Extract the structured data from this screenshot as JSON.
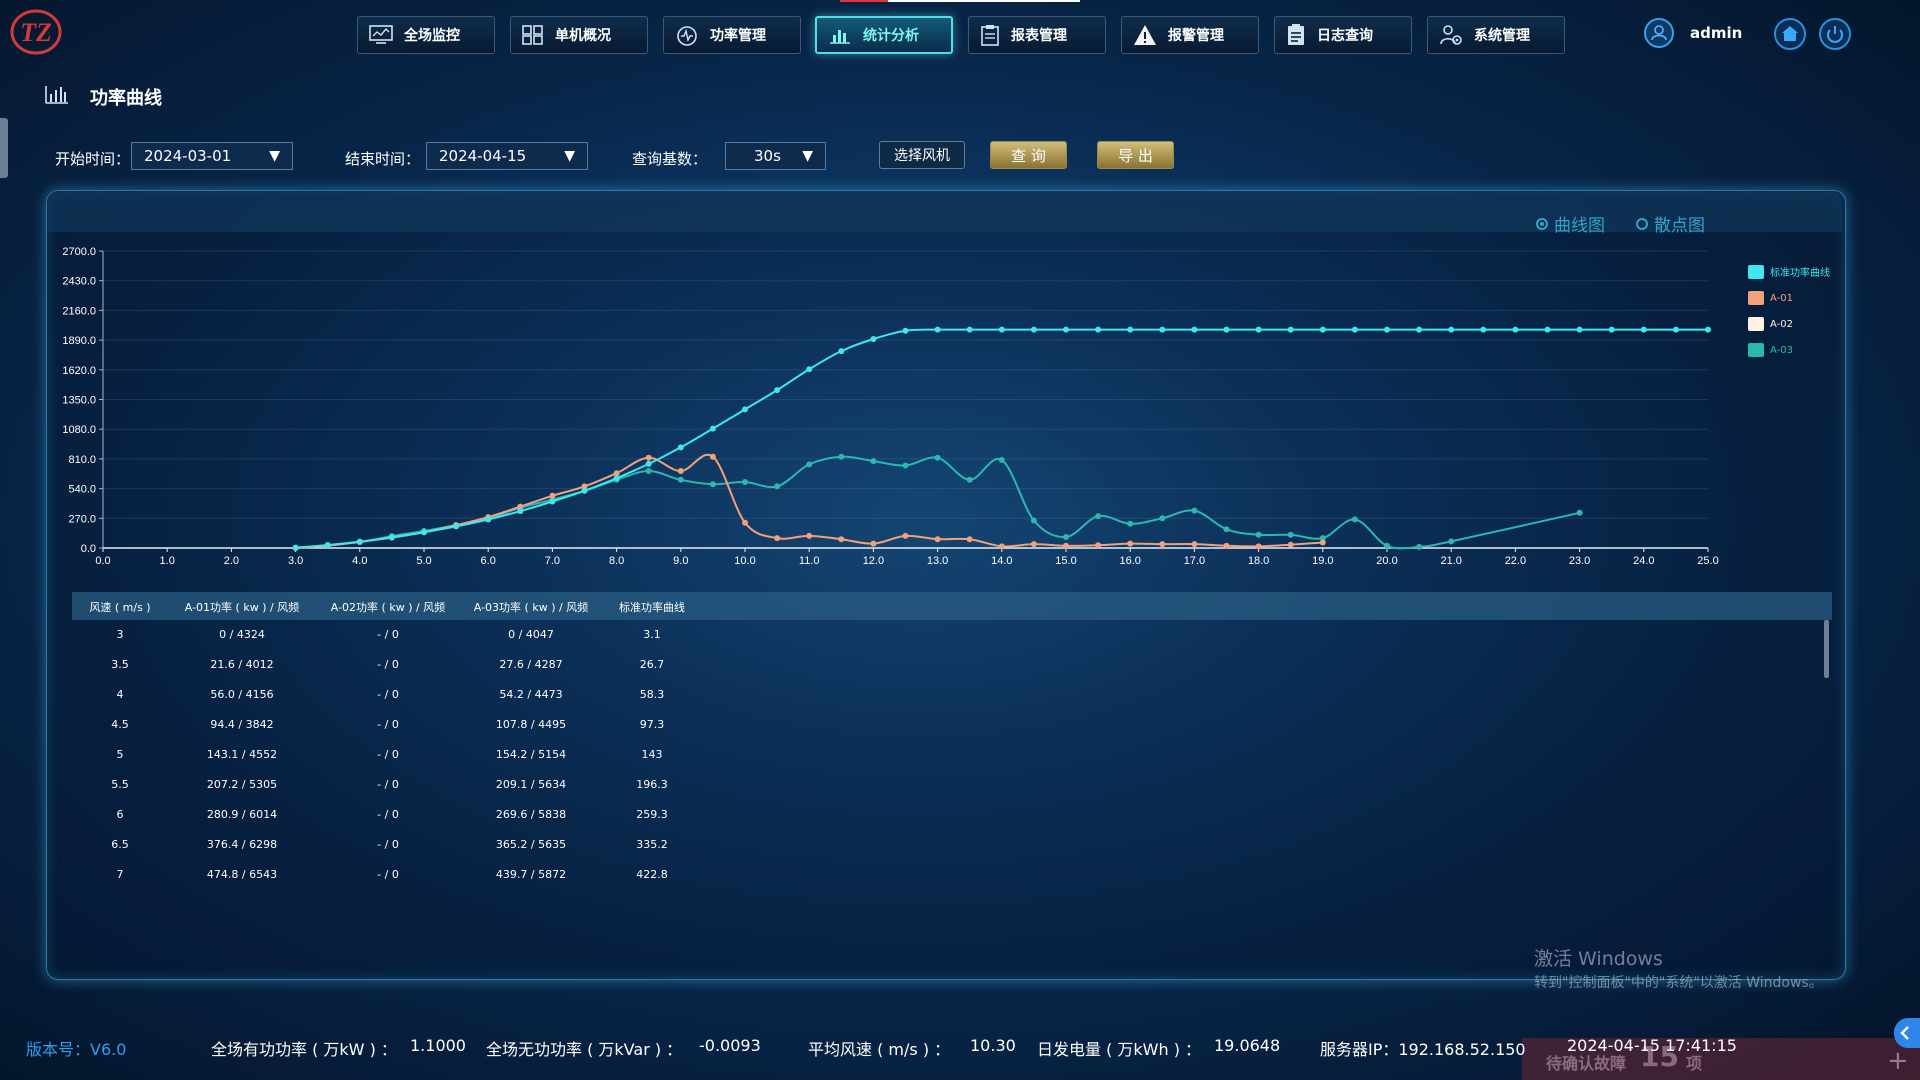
{
  "logo": {
    "text": "TZ"
  },
  "nav": {
    "items": [
      {
        "label": "全场监控",
        "icon": "monitor-icon"
      },
      {
        "label": "单机概况",
        "icon": "grid-icon"
      },
      {
        "label": "功率管理",
        "icon": "power-gauge-icon"
      },
      {
        "label": "统计分析",
        "icon": "bar-chart-icon",
        "active": true
      },
      {
        "label": "报表管理",
        "icon": "clipboard-icon"
      },
      {
        "label": "报警管理",
        "icon": "warning-icon"
      },
      {
        "label": "日志查询",
        "icon": "log-icon"
      },
      {
        "label": "系统管理",
        "icon": "settings-users-icon"
      }
    ],
    "user": "admin"
  },
  "page": {
    "title": "功率曲线"
  },
  "filters": {
    "start_label": "开始时间：",
    "start_value": "2024-03-01",
    "end_label": "结束时间：",
    "end_value": "2024-04-15",
    "base_label": "查询基数：",
    "base_value": "30s",
    "select_turbine": "选择风机",
    "query": "查 询",
    "export": "导 出"
  },
  "view_toggle": {
    "curve": "曲线图",
    "scatter": "散点图",
    "selected": "curve"
  },
  "chart_data": {
    "type": "line",
    "x_ticks": [
      "0.0",
      "1.0",
      "2.0",
      "3.0",
      "4.0",
      "5.0",
      "6.0",
      "7.0",
      "8.0",
      "9.0",
      "10.0",
      "11.0",
      "12.0",
      "13.0",
      "14.0",
      "15.0",
      "16.0",
      "17.0",
      "18.0",
      "19.0",
      "20.0",
      "21.0",
      "22.0",
      "23.0",
      "24.0",
      "25.0"
    ],
    "y_ticks": [
      "0.0",
      "270.0",
      "540.0",
      "810.0",
      "1080.0",
      "1350.0",
      "1620.0",
      "1890.0",
      "2160.0",
      "2430.0",
      "2700.0"
    ],
    "xlim": [
      0,
      25
    ],
    "ylim": [
      0,
      2700
    ],
    "legend_position": "right",
    "series": [
      {
        "name": "标准功率曲线",
        "color": "#3fe6ef",
        "smooth": true,
        "x": [
          3,
          3.5,
          4,
          4.5,
          5,
          5.5,
          6,
          6.5,
          7,
          7.5,
          8,
          8.5,
          9,
          9.5,
          10,
          10.5,
          11,
          11.5,
          12,
          12.5,
          13,
          13.5,
          14,
          14.5,
          15,
          15.5,
          16,
          16.5,
          17,
          17.5,
          18,
          18.5,
          19,
          19.5,
          20,
          20.5,
          21,
          21.5,
          22,
          22.5,
          23,
          23.5,
          24,
          24.5,
          25
        ],
        "y": [
          3.1,
          26.7,
          58.3,
          97.3,
          143,
          196.3,
          259.3,
          335.2,
          422.8,
          520,
          635,
          765,
          915,
          1085,
          1260,
          1435,
          1625,
          1790,
          1900,
          1975,
          1985,
          1985,
          1985,
          1985,
          1985,
          1985,
          1985,
          1985,
          1985,
          1985,
          1985,
          1985,
          1985,
          1985,
          1985,
          1985,
          1985,
          1985,
          1985,
          1985,
          1985,
          1985,
          1985,
          1985,
          1985
        ]
      },
      {
        "name": "A-01",
        "color": "#f4a07a",
        "smooth": true,
        "x": [
          3,
          3.5,
          4,
          4.5,
          5,
          5.5,
          6,
          6.5,
          7,
          7.5,
          8,
          8.5,
          9,
          9.5,
          10,
          10.5,
          11,
          11.5,
          12,
          12.5,
          13,
          13.5,
          14,
          14.5,
          15,
          15.5,
          16,
          16.5,
          17,
          17.5,
          18,
          18.5,
          19
        ],
        "y": [
          0,
          21.6,
          56,
          94.4,
          143.1,
          207.2,
          280.9,
          376.4,
          474.8,
          560,
          680,
          820,
          700,
          830,
          230,
          90,
          110,
          80,
          40,
          110,
          80,
          80,
          15,
          35,
          20,
          25,
          40,
          35,
          35,
          20,
          15,
          30,
          50
        ]
      },
      {
        "name": "A-02",
        "color": "#fff2e0",
        "smooth": true,
        "x": [],
        "y": []
      },
      {
        "name": "A-03",
        "color": "#2bb8b0",
        "smooth": true,
        "x": [
          3,
          3.5,
          4,
          4.5,
          5,
          5.5,
          6,
          6.5,
          7,
          7.5,
          8,
          8.5,
          9,
          9.5,
          10,
          10.5,
          11,
          11.5,
          12,
          12.5,
          13,
          13.5,
          14,
          14.5,
          15,
          15.5,
          16,
          16.5,
          17,
          17.5,
          18,
          18.5,
          19,
          19.5,
          20,
          20.5,
          21,
          23
        ],
        "y": [
          0,
          27.6,
          54.2,
          107.8,
          154.2,
          209.1,
          269.6,
          365.2,
          439.7,
          520,
          620,
          700,
          620,
          580,
          600,
          560,
          760,
          830,
          790,
          750,
          820,
          620,
          800,
          250,
          100,
          290,
          220,
          270,
          340,
          170,
          120,
          120,
          90,
          260,
          20,
          10,
          60,
          320
        ]
      }
    ]
  },
  "table": {
    "headers": [
      "风速 ( m/s )",
      "A-01功率 ( kw ) / 风频",
      "A-02功率 ( kw ) / 风频",
      "A-03功率 ( kw ) / 风频",
      "标准功率曲线"
    ],
    "rows": [
      [
        "3",
        "0 / 4324",
        "- / 0",
        "0 / 4047",
        "3.1"
      ],
      [
        "3.5",
        "21.6 / 4012",
        "- / 0",
        "27.6 / 4287",
        "26.7"
      ],
      [
        "4",
        "56.0 / 4156",
        "- / 0",
        "54.2 / 4473",
        "58.3"
      ],
      [
        "4.5",
        "94.4 / 3842",
        "- / 0",
        "107.8 / 4495",
        "97.3"
      ],
      [
        "5",
        "143.1 / 4552",
        "- / 0",
        "154.2 / 5154",
        "143"
      ],
      [
        "5.5",
        "207.2 / 5305",
        "- / 0",
        "209.1 / 5634",
        "196.3"
      ],
      [
        "6",
        "280.9 / 6014",
        "- / 0",
        "269.6 / 5838",
        "259.3"
      ],
      [
        "6.5",
        "376.4 / 6298",
        "- / 0",
        "365.2 / 5635",
        "335.2"
      ],
      [
        "7",
        "474.8 / 6543",
        "- / 0",
        "439.7 / 5872",
        "422.8"
      ]
    ]
  },
  "watermark": {
    "line1": "激活 Windows",
    "line2": "转到\"控制面板\"中的\"系统\"以激活 Windows。"
  },
  "footer": {
    "version_label": "版本号：V6.0",
    "active_power_label": "全场有功功率 ( 万kW ) ：",
    "active_power_value": "1.1000",
    "reactive_power_label": "全场无功功率 ( 万kVar ) ：",
    "reactive_power_value": "-0.0093",
    "avg_wind_label": "平均风速 ( m/s ) ：",
    "avg_wind_value": "10.30",
    "daily_energy_label": "日发电量 ( 万kWh ) ：",
    "daily_energy_value": "19.0648",
    "server_ip": "服务器IP：192.168.52.150",
    "datetime": "2024-04-15 17:41:15",
    "pending_prefix": "待确认故障",
    "pending_count": "15",
    "pending_suffix": "项"
  }
}
